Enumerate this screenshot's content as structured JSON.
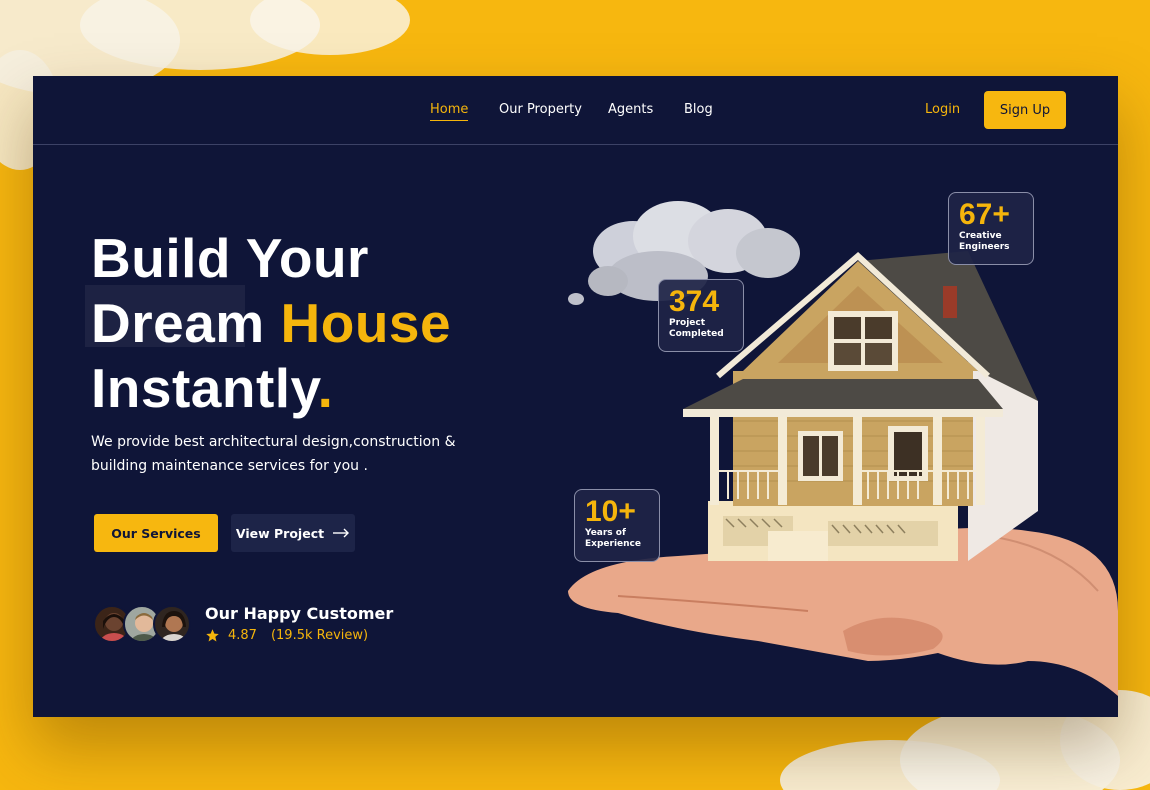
{
  "nav": {
    "items": [
      {
        "label": "Home",
        "active": true
      },
      {
        "label": "Our Property",
        "active": false
      },
      {
        "label": "Agents",
        "active": false
      },
      {
        "label": "Blog",
        "active": false
      }
    ],
    "login_label": "Login",
    "signup_label": "Sign Up"
  },
  "hero": {
    "line1": "Build Your",
    "line2_a": "Dream",
    "line2_b": "House",
    "line3": "Instantly",
    "line3_dot": ".",
    "subtext": "We provide best architectural design,construction & building maintenance services for you .",
    "primary_button": "Our Services",
    "secondary_button": "View Project"
  },
  "customers": {
    "title": "Our Happy Customer",
    "rating": "4.87",
    "reviews": "(19.5k Review)"
  },
  "stats": [
    {
      "value": "67+",
      "label": "Creative\nEngineers"
    },
    {
      "value": "374",
      "label": "Project\nCompleted"
    },
    {
      "value": "10+",
      "label": "Years of\nExperience"
    }
  ],
  "colors": {
    "accent": "#f5b50c",
    "panel": "#0f1538",
    "page_bg": "#f7b70f"
  },
  "icons": {
    "star": "star-icon",
    "arrow": "arrow-right-icon"
  }
}
